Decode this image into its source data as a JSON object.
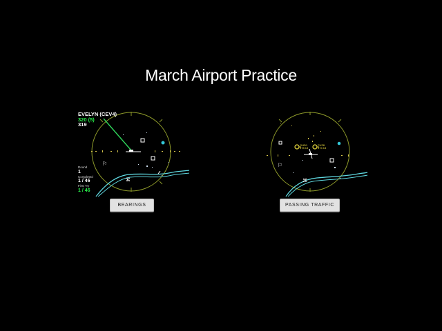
{
  "page": {
    "title": "March Airport Practice"
  },
  "colors": {
    "scope_ring": "#8e9a2a",
    "river": "#5fd8e0",
    "heading_line": "#2fd45a",
    "target": "#f0e040",
    "marker": "#33c8d8",
    "text_green": "#28f04a",
    "button_bg": "#e2e2e2"
  },
  "scopes": {
    "left": {
      "aircraft": {
        "callsign": "EVELYN (CEV4)",
        "heading": "320 (5)",
        "altitude": "319"
      },
      "stats": {
        "round_label": "Round",
        "round_value": "1",
        "completed_label": "Completed",
        "completed_value": "1 / 46",
        "first_try_label": "First Try",
        "first_try_value": "1 / 46"
      },
      "button": {
        "label": "BEARINGS"
      }
    },
    "right": {
      "traffic": [
        {
          "callsign": "GHD1",
          "data": "378 13"
        },
        {
          "callsign": "FUZ8",
          "data": "374 13"
        }
      ],
      "button": {
        "label": "PASSING TRAFFIC"
      }
    }
  }
}
